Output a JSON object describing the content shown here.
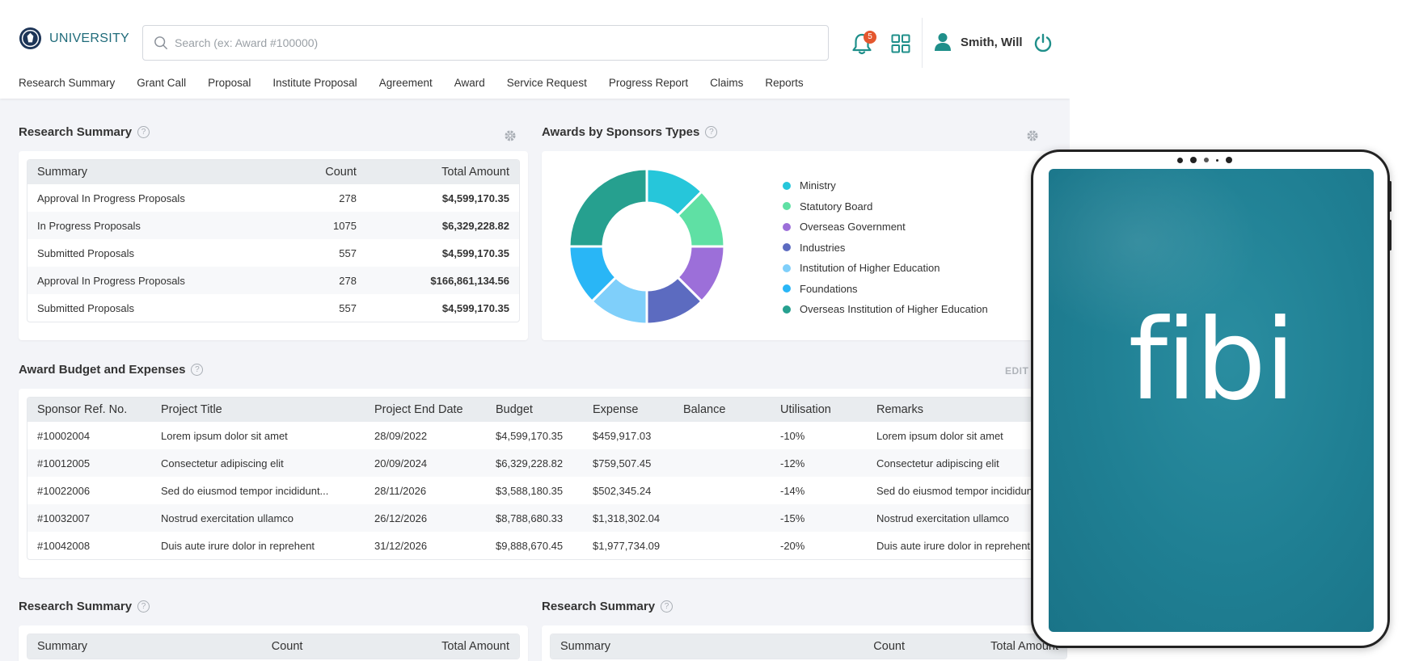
{
  "header": {
    "brand": "UNIVERSITY",
    "search_placeholder": "Search (ex: Award #100000)",
    "notification_count": "5",
    "user_name": "Smith, Will"
  },
  "nav": [
    "Research Summary",
    "Grant Call",
    "Proposal",
    "Institute Proposal",
    "Agreement",
    "Award",
    "Service Request",
    "Progress Report",
    "Claims",
    "Reports"
  ],
  "research_summary": {
    "title": "Research Summary",
    "columns": [
      "Summary",
      "Count",
      "Total Amount"
    ],
    "rows": [
      [
        "Approval In Progress Proposals",
        "278",
        "$4,599,170.35"
      ],
      [
        "In Progress Proposals",
        "1075",
        "$6,329,228.82"
      ],
      [
        "Submitted Proposals",
        "557",
        "$4,599,170.35"
      ],
      [
        "Approval In Progress Proposals",
        "278",
        "$166,861,134.56"
      ],
      [
        "Submitted Proposals",
        "557",
        "$4,599,170.35"
      ]
    ]
  },
  "sponsors": {
    "title": "Awards by Sponsors Types",
    "legend": [
      {
        "label": "Ministry",
        "color": "#26c6da"
      },
      {
        "label": "Statutory Board",
        "color": "#5fe0a4"
      },
      {
        "label": "Overseas Government",
        "color": "#9c6fd9"
      },
      {
        "label": "Industries",
        "color": "#5c6bc0"
      },
      {
        "label": "Institution of Higher Education",
        "color": "#7fcffa"
      },
      {
        "label": "Foundations",
        "color": "#29b6f6"
      },
      {
        "label": "Overseas Institution of Higher Education",
        "color": "#26a08f"
      }
    ]
  },
  "budget": {
    "title": "Award Budget and Expenses",
    "edit_label": "EDIT",
    "columns": [
      "Sponsor Ref. No.",
      "Project Title",
      "Project End Date",
      "Budget",
      "Expense",
      "Balance",
      "Utilisation",
      "Remarks"
    ],
    "rows": [
      [
        "#10002004",
        "Lorem ipsum dolor sit amet",
        "28/09/2022",
        "$4,599,170.35",
        "$459,917.03",
        "",
        "-10%",
        "Lorem ipsum dolor sit amet"
      ],
      [
        "#10012005",
        "Consectetur adipiscing elit",
        "20/09/2024",
        "$6,329,228.82",
        "$759,507.45",
        "",
        "-12%",
        "Consectetur adipiscing elit"
      ],
      [
        "#10022006",
        "Sed do eiusmod tempor incididunt...",
        "28/11/2026",
        "$3,588,180.35",
        "$502,345.24",
        "",
        "-14%",
        "Sed do eiusmod tempor incididunt"
      ],
      [
        "#10032007",
        "Nostrud exercitation ullamco",
        "26/12/2026",
        "$8,788,680.33",
        "$1,318,302.04",
        "",
        "-15%",
        "Nostrud exercitation ullamco"
      ],
      [
        "#10042008",
        "Duis aute irure dolor in reprehent",
        "31/12/2026",
        "$9,888,670.45",
        "$1,977,734.09",
        "",
        "-20%",
        "Duis aute irure dolor in reprehent"
      ]
    ]
  },
  "bottom_left": {
    "title": "Research Summary",
    "columns": [
      "Summary",
      "Count",
      "Total Amount"
    ]
  },
  "bottom_right": {
    "title": "Research Summary",
    "columns": [
      "Summary",
      "Count",
      "Total Amount"
    ]
  },
  "tablet": {
    "logo_text": "fibi"
  },
  "colors": {
    "brand": "#1f6b7a",
    "badge": "#e4572e",
    "tablet_screen": "#1f7f93"
  }
}
